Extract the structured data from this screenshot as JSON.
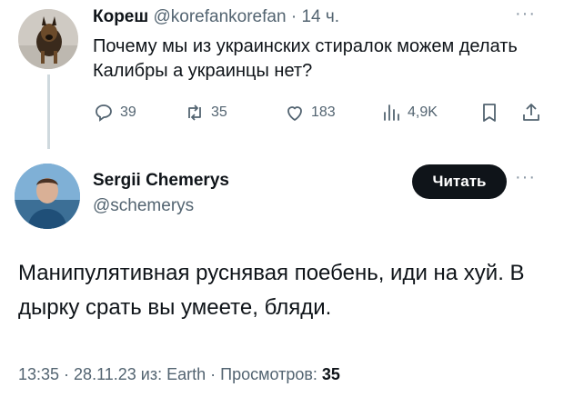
{
  "tweet1": {
    "author_name": "Кореш",
    "author_handle": "@korefankorefan",
    "separator": "·",
    "time": "14 ч.",
    "text": "Почему мы из украинских стиралок можем делать Калибры а украинцы нет?",
    "replies": "39",
    "retweets": "35",
    "likes": "183",
    "views": "4,9K",
    "more_label": "···"
  },
  "tweet2": {
    "author_name": "Sergii Chemerys",
    "author_handle": "@schemerys",
    "follow_label": "Читать",
    "more_label": "···",
    "text": "Манипулятивная руснявая поебень, иди на хуй. В дырку срать вы умеете, бляди.",
    "footer_time": "13:35",
    "footer_sep1": " · ",
    "footer_date": "28.11.23",
    "footer_via": " из: Earth",
    "footer_sep2": " · ",
    "footer_views_label": "Просмотров: ",
    "footer_views": "35"
  },
  "icons": {
    "reply": "reply-icon",
    "retweet": "retweet-icon",
    "like": "heart-icon",
    "views": "views-icon",
    "bookmark": "bookmark-icon",
    "share": "share-icon"
  },
  "colors": {
    "text_primary": "#0f1419",
    "text_secondary": "#536471",
    "thread_line": "#cfd9de",
    "button_bg": "#0f1419"
  }
}
